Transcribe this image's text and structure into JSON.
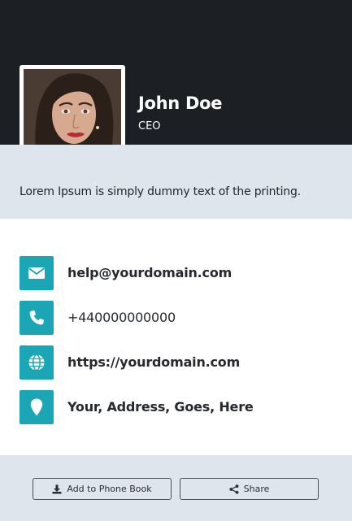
{
  "profile": {
    "name": "John Doe",
    "role": "CEO",
    "bio": "Lorem Ipsum is simply dummy text of the printing."
  },
  "contacts": [
    {
      "icon": "envelope-icon",
      "text": "help@yourdomain.com"
    },
    {
      "icon": "phone-icon",
      "text": "+440000000000"
    },
    {
      "icon": "globe-icon",
      "text": "https://yourdomain.com"
    },
    {
      "icon": "map-marker-icon",
      "text": "Your, Address, Goes, Here"
    }
  ],
  "actions": {
    "add_label": "Add to Phone Book",
    "share_label": "Share"
  },
  "colors": {
    "header_bg": "#1c1f24",
    "accent": "#1aa6b4",
    "band_bg": "#dfe5ec"
  }
}
